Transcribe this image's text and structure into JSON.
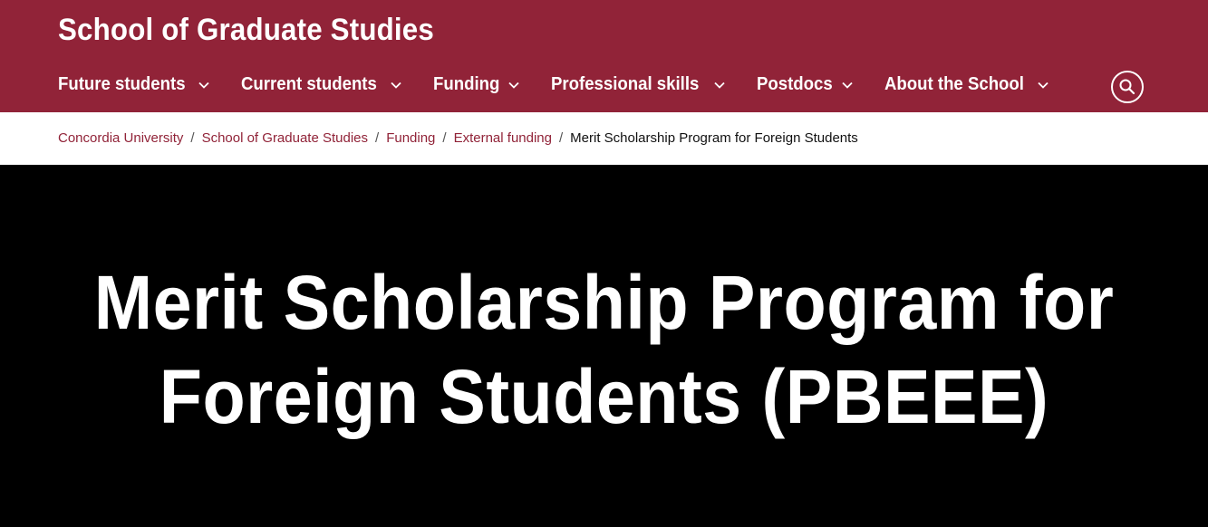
{
  "header": {
    "site_title": "School of Graduate Studies",
    "nav": [
      {
        "label": "Future students"
      },
      {
        "label": "Current students"
      },
      {
        "label": "Funding"
      },
      {
        "label": "Professional skills"
      },
      {
        "label": "Postdocs"
      },
      {
        "label": "About the School"
      }
    ],
    "search_icon": "search-icon"
  },
  "breadcrumb": {
    "items": [
      {
        "label": "Concordia University"
      },
      {
        "label": "School of Graduate Studies"
      },
      {
        "label": "Funding"
      },
      {
        "label": "External funding"
      }
    ],
    "separator": "/",
    "current": "Merit Scholarship Program for Foreign Students"
  },
  "hero": {
    "title_line1": "Merit Scholarship Program for",
    "title_line2": "Foreign Students (PBEEE)"
  },
  "colors": {
    "brand": "#912338",
    "hero_bg": "#000000",
    "header_text": "#ffffff"
  }
}
